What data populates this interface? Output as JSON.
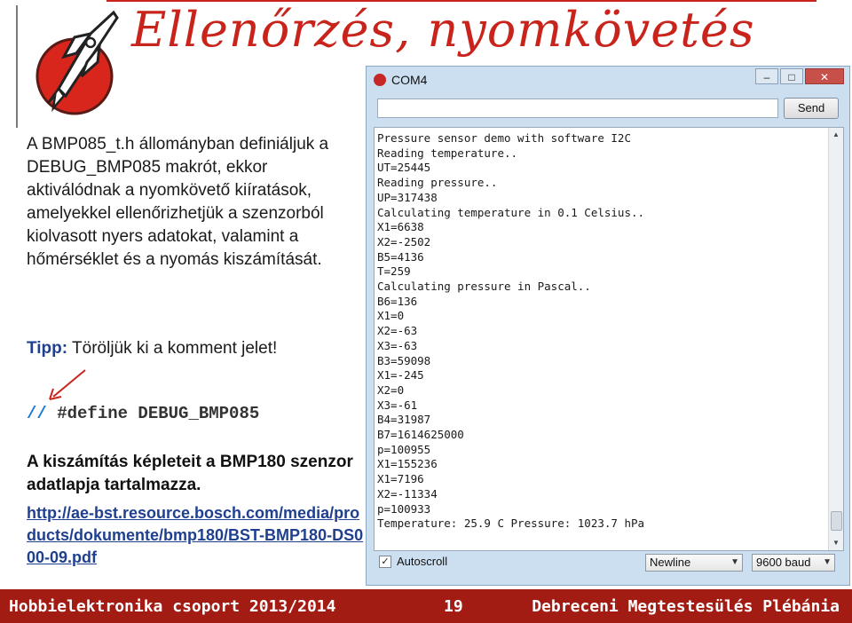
{
  "slide": {
    "title": "Ellenőrzés, nyomkövetés",
    "paragraph": "A BMP085_t.h állományban definiáljuk a DEBUG_BMP085 makrót, ekkor aktiválódnak a nyomkövető kiíratások, amelyekkel ellenőrizhetjük a szenzorból kiolvasott nyers adatokat, valamint a hőmérséklet és a nyomás kiszámítását.",
    "tip_label": "Tipp:",
    "tip_text": " Töröljük ki a komment jelet!",
    "define_comment": "//",
    "define_text": " #define DEBUG_BMP085",
    "formula_note": "A kiszámítás képleteit a BMP180 szenzor adatlapja tartalmazza.",
    "link": "http://ae-bst.resource.bosch.com/media/products/dokumente/bmp180/BST-BMP180-DS000-09.pdf"
  },
  "serial_monitor": {
    "title": "COM4",
    "send_label": "Send",
    "controls": [
      "–",
      "□",
      "✕"
    ],
    "output": [
      "Pressure sensor demo with software I2C",
      "Reading temperature..",
      "UT=25445",
      "Reading pressure..",
      "UP=317438",
      "Calculating temperature in 0.1 Celsius..",
      "X1=6638",
      "X2=-2502",
      "B5=4136",
      "T=259",
      "Calculating pressure in Pascal..",
      "B6=136",
      "X1=0",
      "X2=-63",
      "X3=-63",
      "B3=59098",
      "X1=-245",
      "X2=0",
      "X3=-61",
      "B4=31987",
      "B7=1614625000",
      "p=100955",
      "X1=155236",
      "X1=7196",
      "X2=-11334",
      "p=100933",
      "Temperature: 25.9 C Pressure: 1023.7 hPa"
    ],
    "autoscroll_label": "Autoscroll",
    "autoscroll_checked": "✓",
    "line_ending": "Newline",
    "baud": "9600 baud"
  },
  "footer": {
    "left": "Hobbielektronika csoport 2013/2014",
    "page": "19",
    "right": "Debreceni Megtestesülés Plébánia"
  },
  "colors": {
    "accent": "#c8241c",
    "footer_bg": "#a31c14",
    "link": "#1f3f8f"
  }
}
